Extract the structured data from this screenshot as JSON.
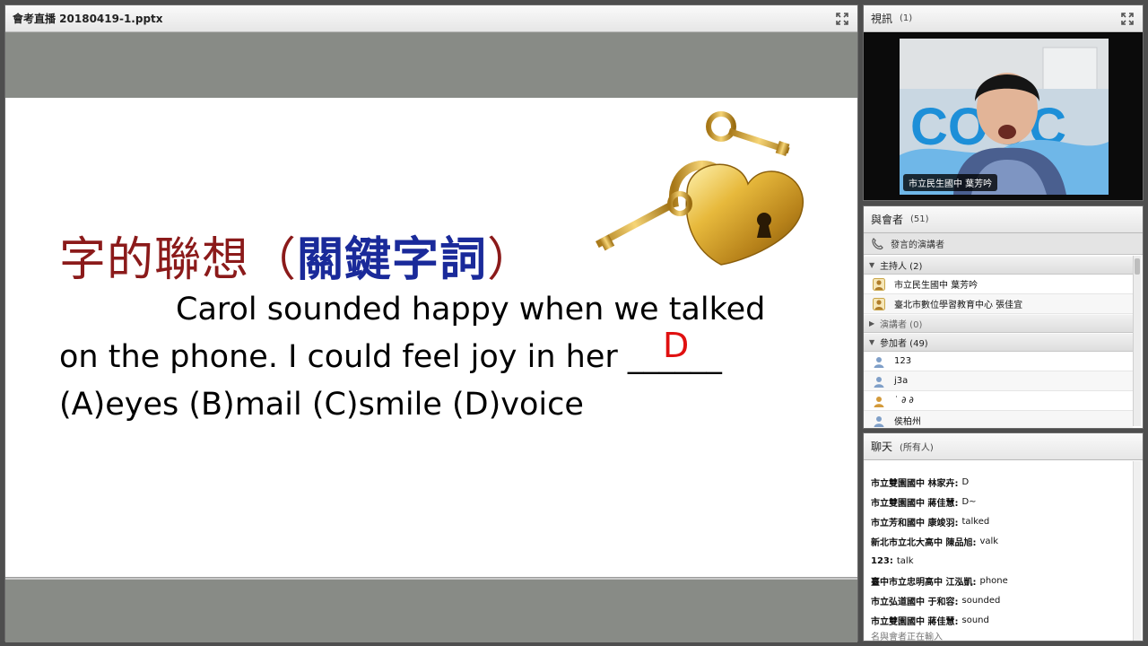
{
  "main_pod": {
    "title": "會考直播 20180419-1.pptx",
    "slide": {
      "heading_part1": "字的聯想（",
      "heading_part2": "關鍵字詞",
      "heading_part3": "）",
      "line1": "Carol sounded happy when we talked",
      "line2": "on the phone. I could feel joy in her ______",
      "line3": "(A)eyes (B)mail (C)smile (D)voice",
      "answer": "D"
    }
  },
  "video_pod": {
    "title": "視訊",
    "count": "(1)",
    "caption": "市立民生國中 葉芳吟",
    "backdrop_text": "COOC"
  },
  "attendees_pod": {
    "title": "與會者",
    "count": "(51)",
    "active_speakers": "發言的演講者",
    "groups": [
      {
        "label": "主持人 (2)",
        "expanded": true
      },
      {
        "label": "演講者 (0)",
        "expanded": false
      },
      {
        "label": "參加者 (49)",
        "expanded": true
      }
    ],
    "hosts": [
      "市立民生國中 葉芳吟",
      "臺北市數位學習教育中心 張佳宜"
    ],
    "participants": [
      "123",
      "j3a",
      "˙ ∂ ∂",
      "侯柏州"
    ]
  },
  "chat_pod": {
    "title": "聊天",
    "scope": "(所有人)",
    "messages": [
      {
        "who": "市立雙園國中 林家卉:",
        "text": "D"
      },
      {
        "who": "市立雙園國中 蔣佳慧:",
        "text": "D~"
      },
      {
        "who": "市立芳和國中 康竣羽:",
        "text": "talked"
      },
      {
        "who": "新北市立北大高中 陳品旭:",
        "text": "valk"
      },
      {
        "who": "123:",
        "text": "talk"
      },
      {
        "who": "臺中市立忠明高中 江泓凱:",
        "text": "phone"
      },
      {
        "who": "市立弘道國中 于和容:",
        "text": "sounded"
      },
      {
        "who": "市立雙園國中 蔣佳慧:",
        "text": "sound"
      }
    ],
    "typing": "名與會者正在輸入"
  },
  "colors": {
    "heading_red": "#8b1a1a",
    "heading_blue": "#1a2a9a",
    "answer_red": "#e01010",
    "band_gray": "#888b86"
  }
}
